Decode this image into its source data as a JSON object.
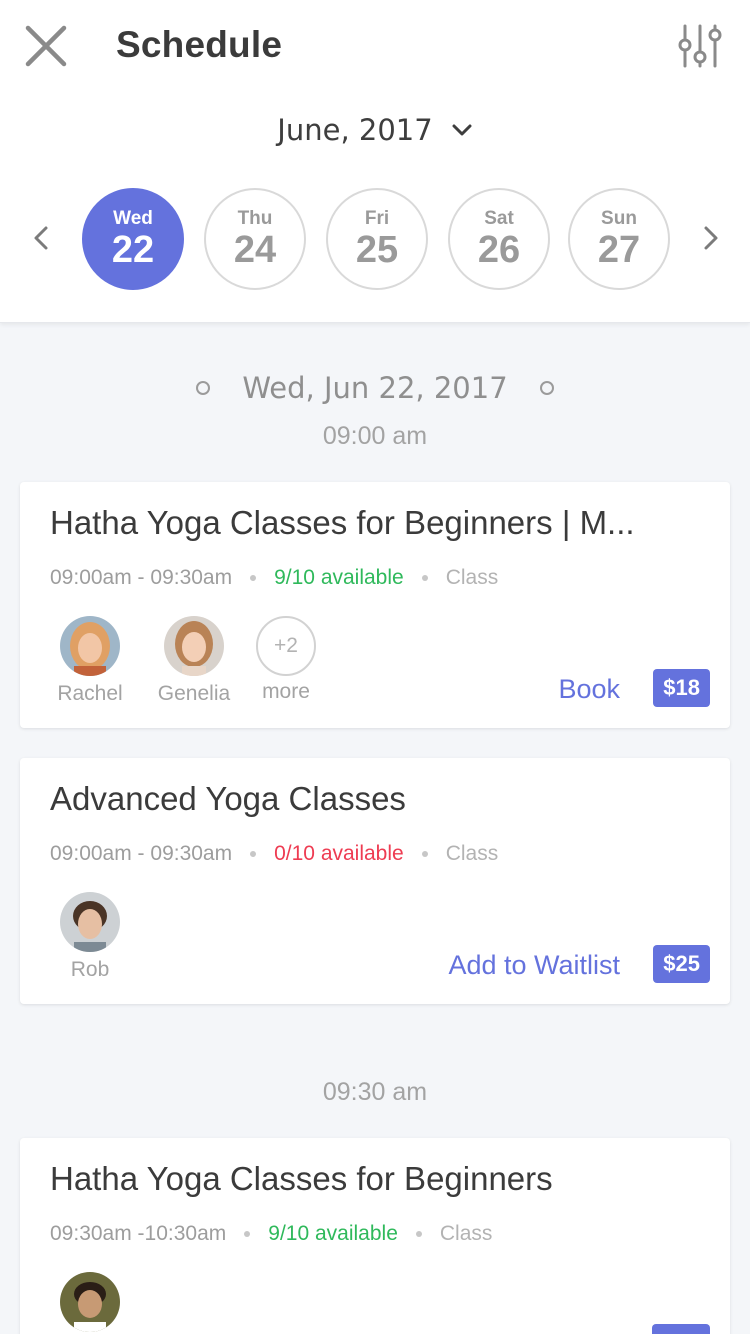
{
  "header": {
    "title": "Schedule",
    "close_icon": "close-icon",
    "filter_icon": "sliders-icon",
    "month": "June, 2017"
  },
  "week": {
    "days": [
      {
        "dow": "Wed",
        "num": "22",
        "selected": true
      },
      {
        "dow": "Thu",
        "num": "24",
        "selected": false
      },
      {
        "dow": "Fri",
        "num": "25",
        "selected": false
      },
      {
        "dow": "Sat",
        "num": "26",
        "selected": false
      },
      {
        "dow": "Sun",
        "num": "27",
        "selected": false
      }
    ]
  },
  "schedule": {
    "date_heading": "Wed, Jun 22, 2017",
    "slots": [
      {
        "time": "09:00 am",
        "classes": [
          {
            "title": "Hatha Yoga Classes for Beginners | M...",
            "time_range": "09:00am - 09:30am",
            "availability": "9/10 available",
            "type": "Class",
            "instructors": [
              "Rachel",
              "Genelia"
            ],
            "more_count": "+2",
            "more_label": "more",
            "action": "Book",
            "price": "$18"
          },
          {
            "title": "Advanced Yoga Classes",
            "time_range": "09:00am - 09:30am",
            "availability": "0/10 available",
            "type": "Class",
            "instructors": [
              "Rob"
            ],
            "action": "Add to Waitlist",
            "price": "$25"
          }
        ]
      },
      {
        "time": "09:30 am",
        "classes": [
          {
            "title": "Hatha Yoga Classes for Beginners",
            "time_range": "09:30am -10:30am",
            "availability": "9/10 available",
            "type": "Class"
          }
        ]
      }
    ]
  },
  "colors": {
    "accent": "#6472dd",
    "available": "#2fb95b",
    "full": "#ee3c52"
  }
}
